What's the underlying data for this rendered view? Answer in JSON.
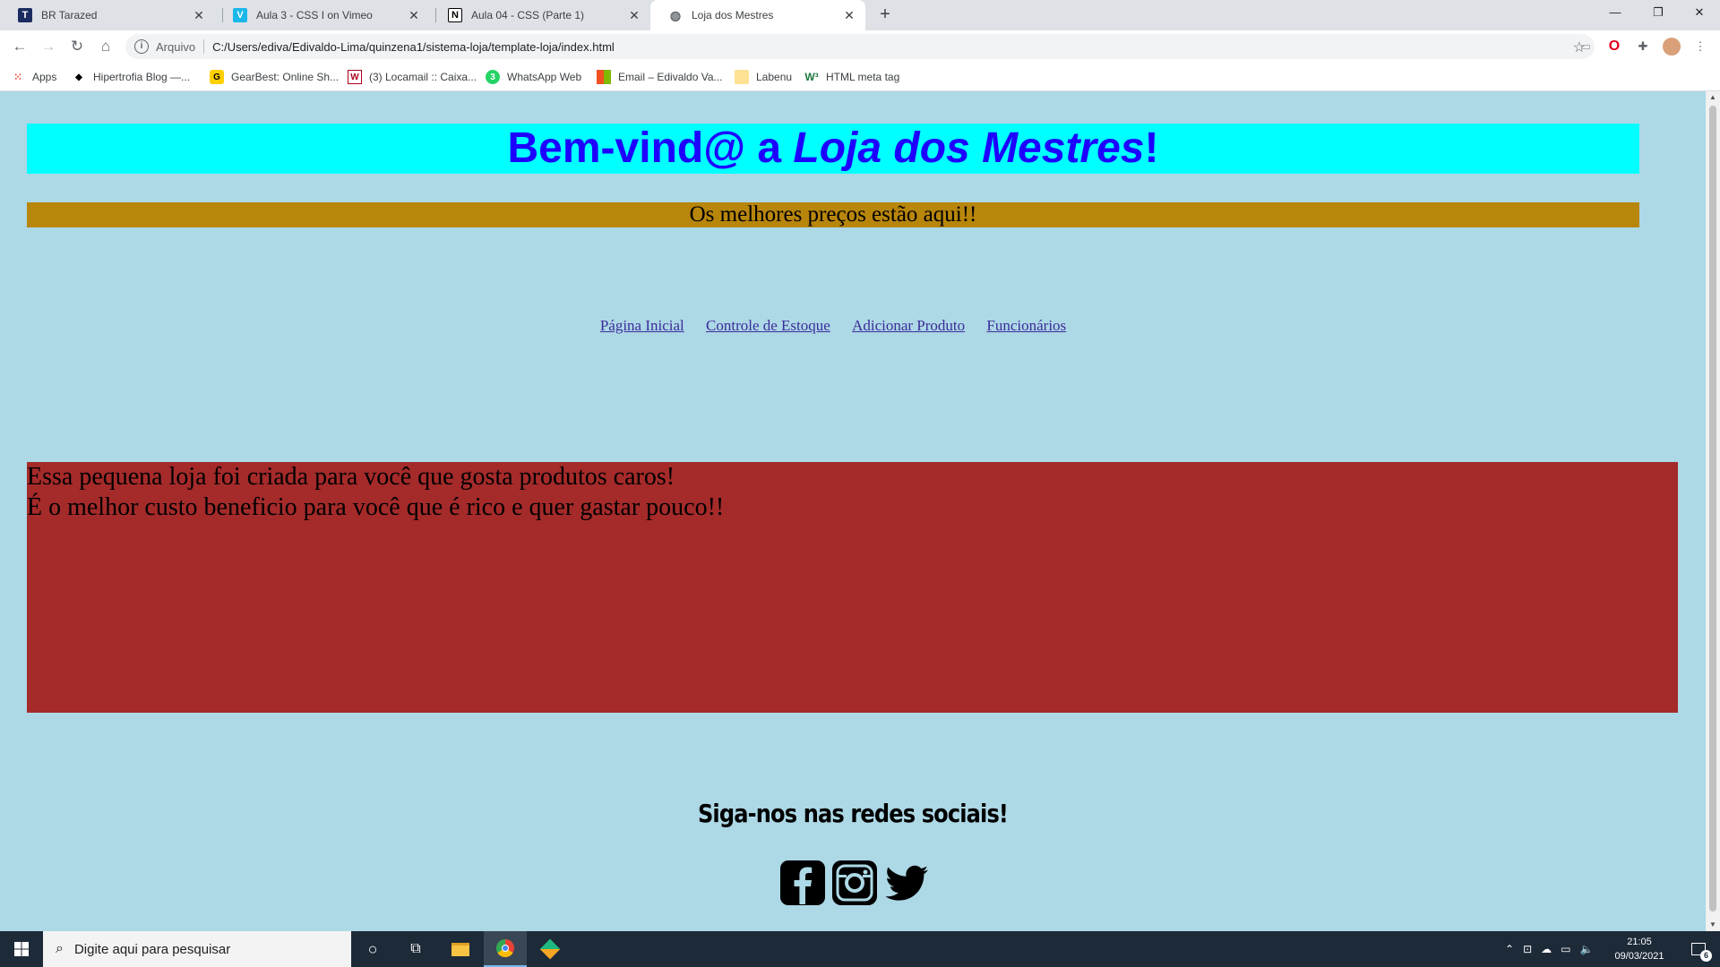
{
  "browser": {
    "tabs": [
      {
        "title": "BR Tarazed",
        "icon": "tarazed-icon"
      },
      {
        "title": "Aula 3 - CSS I on Vimeo",
        "icon": "vimeo-icon"
      },
      {
        "title": "Aula 04 - CSS (Parte 1)",
        "icon": "notion-icon"
      },
      {
        "title": "Loja dos Mestres",
        "icon": "globe-icon"
      }
    ],
    "address": {
      "label": "Arquivo",
      "url": "C:/Users/ediva/Edivaldo-Lima/quinzena1/sistema-loja/template-loja/index.html"
    },
    "bookmarks": [
      {
        "label": "Apps"
      },
      {
        "label": "Hipertrofia Blog —..."
      },
      {
        "label": "GearBest: Online Sh..."
      },
      {
        "label": "(3) Locamail :: Caixa..."
      },
      {
        "label": "WhatsApp Web"
      },
      {
        "label": "Email – Edivaldo Va..."
      },
      {
        "label": "Labenu"
      },
      {
        "label": "HTML meta tag"
      }
    ]
  },
  "page": {
    "banner": {
      "prefix": "Bem-vind@ a ",
      "italic": "Loja dos Mestres",
      "suffix": "!"
    },
    "tagline": "Os melhores preços estão aqui!!",
    "menu": [
      "Página Inicial",
      "Controle de Estoque",
      "Adicionar Produto",
      "Funcionários"
    ],
    "about": {
      "line1": "Essa pequena loja foi criada para você que gosta produtos caros!",
      "line2": "É o melhor custo beneficio para você que é rico e quer gastar pouco!!"
    },
    "social_title": "Siga-nos nas redes sociais!",
    "social_icons": [
      "facebook-icon",
      "instagram-icon",
      "twitter-icon"
    ]
  },
  "taskbar": {
    "search_placeholder": "Digite aqui para pesquisar",
    "time": "21:05",
    "date": "09/03/2021",
    "notifications": "6"
  },
  "colors": {
    "page_bg": "#add8e6",
    "banner_bg": "#00ffff",
    "banner_text": "#1e00ff",
    "tagline_bg": "#b8860b",
    "about_bg": "#a52a2a",
    "link": "#3c2d9a"
  }
}
